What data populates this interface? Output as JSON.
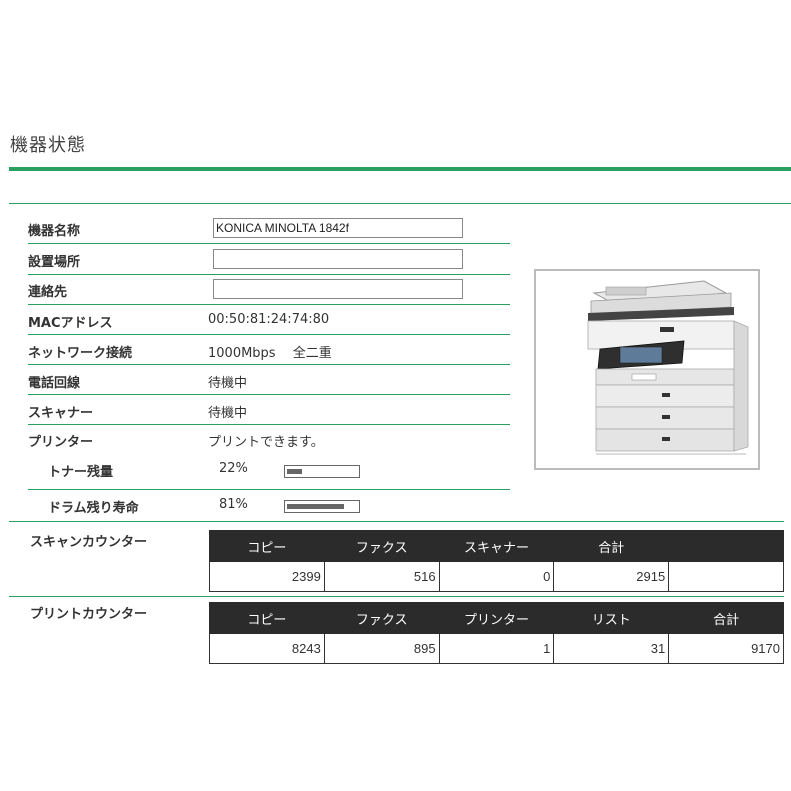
{
  "page": {
    "title": "機器状態"
  },
  "device": {
    "name": {
      "label": "機器名称",
      "value": "KONICA MINOLTA 1842f"
    },
    "location": {
      "label": "設置場所",
      "value": ""
    },
    "contact": {
      "label": "連絡先",
      "value": ""
    },
    "mac": {
      "label": "MACアドレス",
      "value": "00:50:81:24:74:80"
    },
    "network": {
      "label": "ネットワーク接続",
      "value": "1000Mbps　 全二重"
    },
    "phone_line": {
      "label": "電話回線",
      "value": "待機中"
    },
    "scanner": {
      "label": "スキャナー",
      "value": "待機中"
    },
    "printer": {
      "label": "プリンター",
      "value": "プリントできます。"
    },
    "toner": {
      "label": "トナー残量",
      "value": "22%",
      "level": 0.22
    },
    "drum": {
      "label": "ドラム残り寿命",
      "value": "81%",
      "level": 0.81
    }
  },
  "scan_counter": {
    "label": "スキャンカウンター",
    "headers": [
      "コピー",
      "ファクス",
      "スキャナー",
      "合計",
      ""
    ],
    "values": [
      "2399",
      "516",
      "0",
      "2915",
      ""
    ]
  },
  "print_counter": {
    "label": "プリントカウンター",
    "headers": [
      "コピー",
      "ファクス",
      "プリンター",
      "リスト",
      "合計"
    ],
    "values": [
      "8243",
      "895",
      "1",
      "31",
      "9170"
    ]
  },
  "colors": {
    "accent": "#2aa060",
    "header_bg": "#2b2b2b"
  },
  "image": {
    "icon": "printer-icon"
  }
}
